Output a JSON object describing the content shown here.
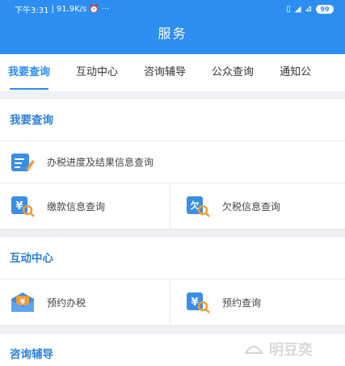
{
  "status_bar": {
    "time": "下午3:31",
    "network_speed": "91.9K/s",
    "extra": "···",
    "battery": "99"
  },
  "header": {
    "title": "服务"
  },
  "tabs": [
    {
      "label": "我要查询"
    },
    {
      "label": "互动中心"
    },
    {
      "label": "咨询辅导"
    },
    {
      "label": "公众查询"
    },
    {
      "label": "通知公"
    }
  ],
  "sections": {
    "query": {
      "title": "我要查询",
      "items": [
        {
          "label": "办税进度及结果信息查询"
        },
        {
          "label": "缴款信息查询"
        },
        {
          "label": "欠税信息查询"
        }
      ]
    },
    "interaction": {
      "title": "互动中心",
      "items": [
        {
          "label": "预约办税"
        },
        {
          "label": "预约查询"
        }
      ]
    },
    "consult": {
      "title": "咨询辅导"
    }
  },
  "watermark": {
    "text": "明豆奕"
  },
  "colors": {
    "accent": "#2c8ef0",
    "section_title": "#2c7fd9",
    "icon_orange": "#f29b38"
  }
}
